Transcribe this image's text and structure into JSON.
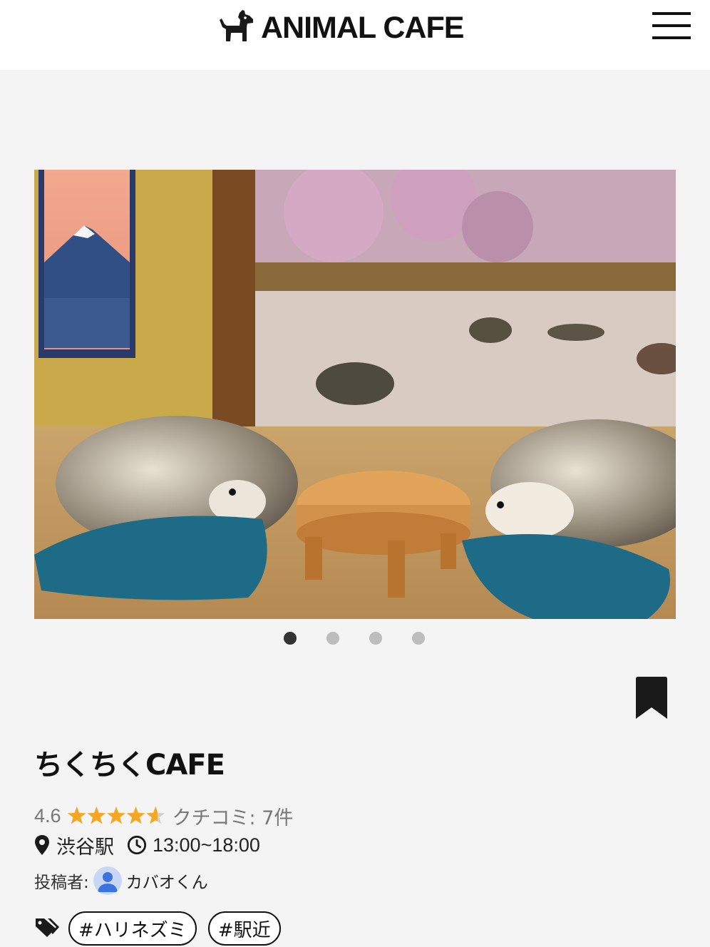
{
  "header": {
    "logo_text": "ANIMAL CAFE",
    "logo_icon": "dog-icon",
    "menu_icon": "hamburger-menu-icon"
  },
  "carousel": {
    "slide_count": 4,
    "active_index": 0,
    "active_color": "#333333",
    "inactive_color": "#bdbdbd"
  },
  "bookmark_icon": "bookmark-icon",
  "cafe": {
    "name": "ちくちくCAFE",
    "rating": "4.6",
    "rating_value": 4.6,
    "rating_max": 5,
    "star_color": "#f5a623",
    "reviews": "クチコミ: 7件",
    "station": "渋谷駅",
    "hours": "13:00~18:00"
  },
  "poster": {
    "label": "投稿者:",
    "name": "カバオくん"
  },
  "tags": [
    "#ハリネズミ",
    "#駅近"
  ],
  "icons": [
    "map-pin-icon",
    "clock-icon",
    "tags-icon",
    "user-avatar-icon"
  ]
}
